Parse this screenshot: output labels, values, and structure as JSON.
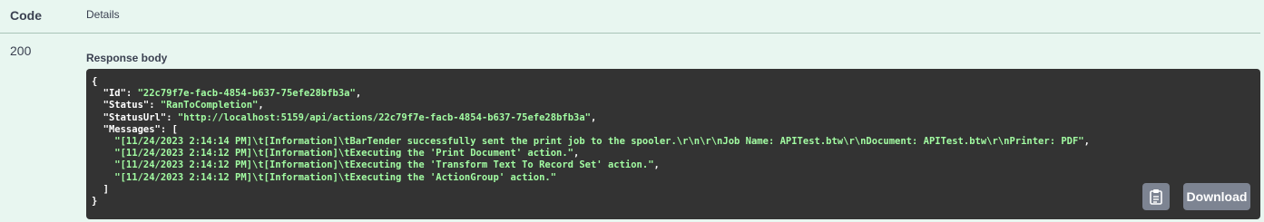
{
  "table": {
    "code_header": "Code",
    "details_header": "Details"
  },
  "response": {
    "status_code": "200",
    "body_label": "Response body",
    "lines": [
      {
        "parts": [
          {
            "t": "{",
            "c": "p"
          }
        ]
      },
      {
        "parts": [
          {
            "t": "  \"Id\"",
            "c": "k"
          },
          {
            "t": ": ",
            "c": "p"
          },
          {
            "t": "\"22c79f7e-facb-4854-b637-75efe28bfb3a\"",
            "c": "s"
          },
          {
            "t": ",",
            "c": "p"
          }
        ]
      },
      {
        "parts": [
          {
            "t": "  \"Status\"",
            "c": "k"
          },
          {
            "t": ": ",
            "c": "p"
          },
          {
            "t": "\"RanToCompletion\"",
            "c": "s"
          },
          {
            "t": ",",
            "c": "p"
          }
        ]
      },
      {
        "parts": [
          {
            "t": "  \"StatusUrl\"",
            "c": "k"
          },
          {
            "t": ": ",
            "c": "p"
          },
          {
            "t": "\"http://localhost:5159/api/actions/22c79f7e-facb-4854-b637-75efe28bfb3a\"",
            "c": "s"
          },
          {
            "t": ",",
            "c": "p"
          }
        ]
      },
      {
        "parts": [
          {
            "t": "  \"Messages\"",
            "c": "k"
          },
          {
            "t": ": [",
            "c": "p"
          }
        ]
      },
      {
        "parts": [
          {
            "t": "    \"[11/24/2023 2:14:14 PM]\\t[Information]\\tBarTender successfully sent the print job to the spooler.\\r\\n\\r\\nJob Name: APITest.btw\\r\\nDocument: APITest.btw\\r\\nPrinter: PDF\"",
            "c": "s"
          },
          {
            "t": ",",
            "c": "p"
          }
        ]
      },
      {
        "parts": [
          {
            "t": "    \"[11/24/2023 2:14:12 PM]\\t[Information]\\tExecuting the 'Print Document' action.\"",
            "c": "s"
          },
          {
            "t": ",",
            "c": "p"
          }
        ]
      },
      {
        "parts": [
          {
            "t": "    \"[11/24/2023 2:14:12 PM]\\t[Information]\\tExecuting the 'Transform Text To Record Set' action.\"",
            "c": "s"
          },
          {
            "t": ",",
            "c": "p"
          }
        ]
      },
      {
        "parts": [
          {
            "t": "    \"[11/24/2023 2:14:12 PM]\\t[Information]\\tExecuting the 'ActionGroup' action.\"",
            "c": "s"
          }
        ]
      },
      {
        "parts": [
          {
            "t": "  ]",
            "c": "p"
          }
        ]
      },
      {
        "parts": [
          {
            "t": "}",
            "c": "p"
          }
        ]
      }
    ]
  },
  "buttons": {
    "copy_icon": "clipboard-icon",
    "download_label": "Download"
  },
  "colors": {
    "background": "#e8f6f0",
    "code_background": "#333333",
    "string_color": "#a2fca2",
    "button_color": "#7d8492"
  }
}
